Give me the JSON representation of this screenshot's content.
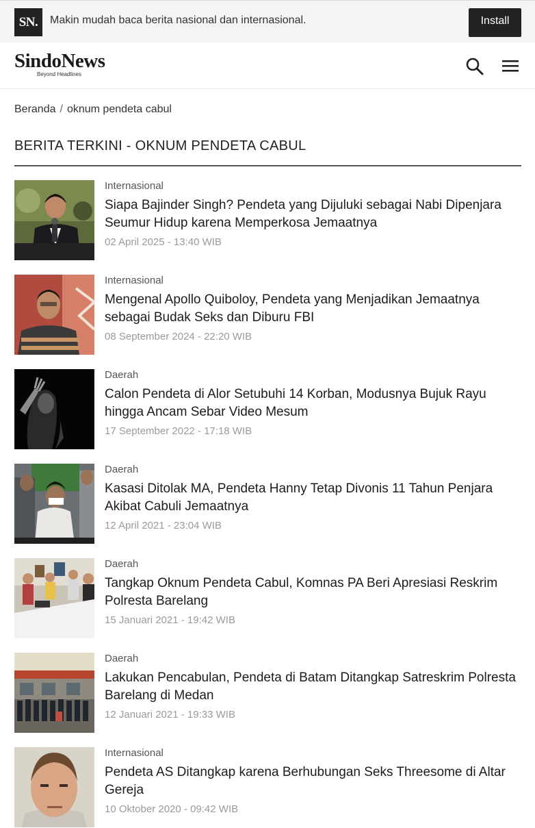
{
  "banner": {
    "logo": "SN.",
    "text": "Makin mudah baca berita nasional dan internasional.",
    "install_label": "Install"
  },
  "header": {
    "brand_name": "SindoNews",
    "brand_tagline": "Beyond Headlines",
    "icons": [
      "search-icon",
      "hamburger-menu-icon"
    ]
  },
  "breadcrumb": {
    "home": "Beranda",
    "separator": "/",
    "current": "oknum pendeta cabul"
  },
  "section_title": "BERITA TERKINI - OKNUM PENDETA CABUL",
  "news": [
    {
      "category": "Internasional",
      "title": "Siapa Bajinder Singh? Pendeta yang Dijuluki sebagai Nabi Dipenjara Seumur Hidup karena Memperkosa Jemaatnya",
      "date": "02 April 2025 - 13:40 WIB"
    },
    {
      "category": "Internasional",
      "title": "Mengenal Apollo Quiboloy, Pendeta yang Menjadikan Jemaatnya sebagai Budak Seks dan Diburu FBI",
      "date": "08 September 2024 - 22:20 WIB"
    },
    {
      "category": "Daerah",
      "title": "Calon Pendeta di Alor Setubuhi 14 Korban, Modusnya Bujuk Rayu hingga Ancam Sebar Video Mesum",
      "date": "17 September 2022 - 17:18 WIB"
    },
    {
      "category": "Daerah",
      "title": "Kasasi Ditolak MA, Pendeta Hanny Tetap Divonis 11 Tahun Penjara Akibat Cabuli Jemaatnya",
      "date": "12 April 2021 - 23:04 WIB"
    },
    {
      "category": "Daerah",
      "title": "Tangkap Oknum Pendeta Cabul, Komnas PA Beri Apresiasi Reskrim Polresta Barelang",
      "date": "15 Januari 2021 - 19:42 WIB"
    },
    {
      "category": "Daerah",
      "title": "Lakukan Pencabulan, Pendeta di Batam Ditangkap Satreskrim Polresta Barelang di Medan",
      "date": "12 Januari 2021 - 19:33 WIB"
    },
    {
      "category": "Internasional",
      "title": "Pendeta AS Ditangkap karena Berhubungan Seks Threesome di Altar Gereja",
      "date": "10 Oktober 2020 - 09:42 WIB"
    }
  ]
}
